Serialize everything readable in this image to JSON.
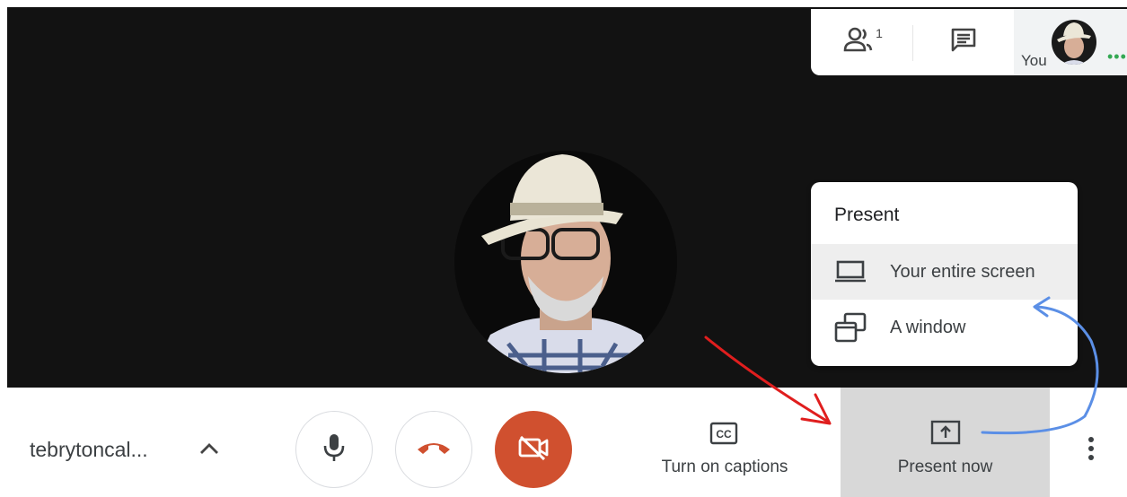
{
  "topbar": {
    "participants_count": "1",
    "self_label": "You",
    "icons": {
      "people": "people-icon",
      "chat": "chat-icon",
      "more": "more-dots-icon"
    }
  },
  "present_menu": {
    "title": "Present",
    "items": [
      {
        "label": "Your entire screen",
        "icon": "laptop-icon",
        "hovered": true
      },
      {
        "label": "A window",
        "icon": "window-icon",
        "hovered": false
      }
    ]
  },
  "bottombar": {
    "meeting_name": "tebrytoncal...",
    "captions_label": "Turn on captions",
    "present_label": "Present now",
    "icons": {
      "expand": "chevron-up-icon",
      "mic": "microphone-icon",
      "hangup": "hang-up-icon",
      "camera": "camera-off-icon",
      "captions": "closed-captions-icon",
      "present": "present-screen-icon",
      "more": "more-vert-icon"
    }
  },
  "colors": {
    "video_bg": "#121212",
    "accent_red": "#d0502f",
    "present_bg": "#d8d8d8",
    "annotation_red": "#e01e1e",
    "annotation_blue": "#5b8fe6"
  }
}
